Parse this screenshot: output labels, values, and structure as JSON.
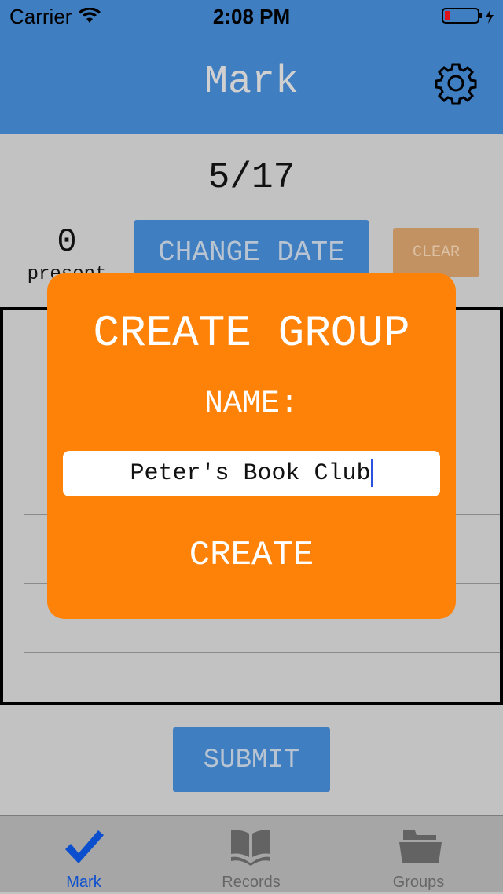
{
  "status_bar": {
    "carrier": "Carrier",
    "time": "2:08 PM"
  },
  "header": {
    "title": "Mark"
  },
  "main": {
    "date": "5/17",
    "present_count": "0",
    "present_label": "present",
    "change_date_label": "CHANGE DATE",
    "clear_label": "CLEAR",
    "submit_label": "SUBMIT"
  },
  "modal": {
    "title": "CREATE GROUP",
    "name_label": "NAME:",
    "name_value": "Peter's Book Club",
    "create_label": "CREATE"
  },
  "tabs": [
    {
      "label": "Mark",
      "icon": "checkmark-icon",
      "active": true
    },
    {
      "label": "Records",
      "icon": "book-icon"
    },
    {
      "label": "Groups",
      "icon": "folder-icon"
    }
  ],
  "colors": {
    "accent": "#3e7ec1",
    "modal": "#fe8208",
    "active_tab": "#0b4fcf"
  }
}
